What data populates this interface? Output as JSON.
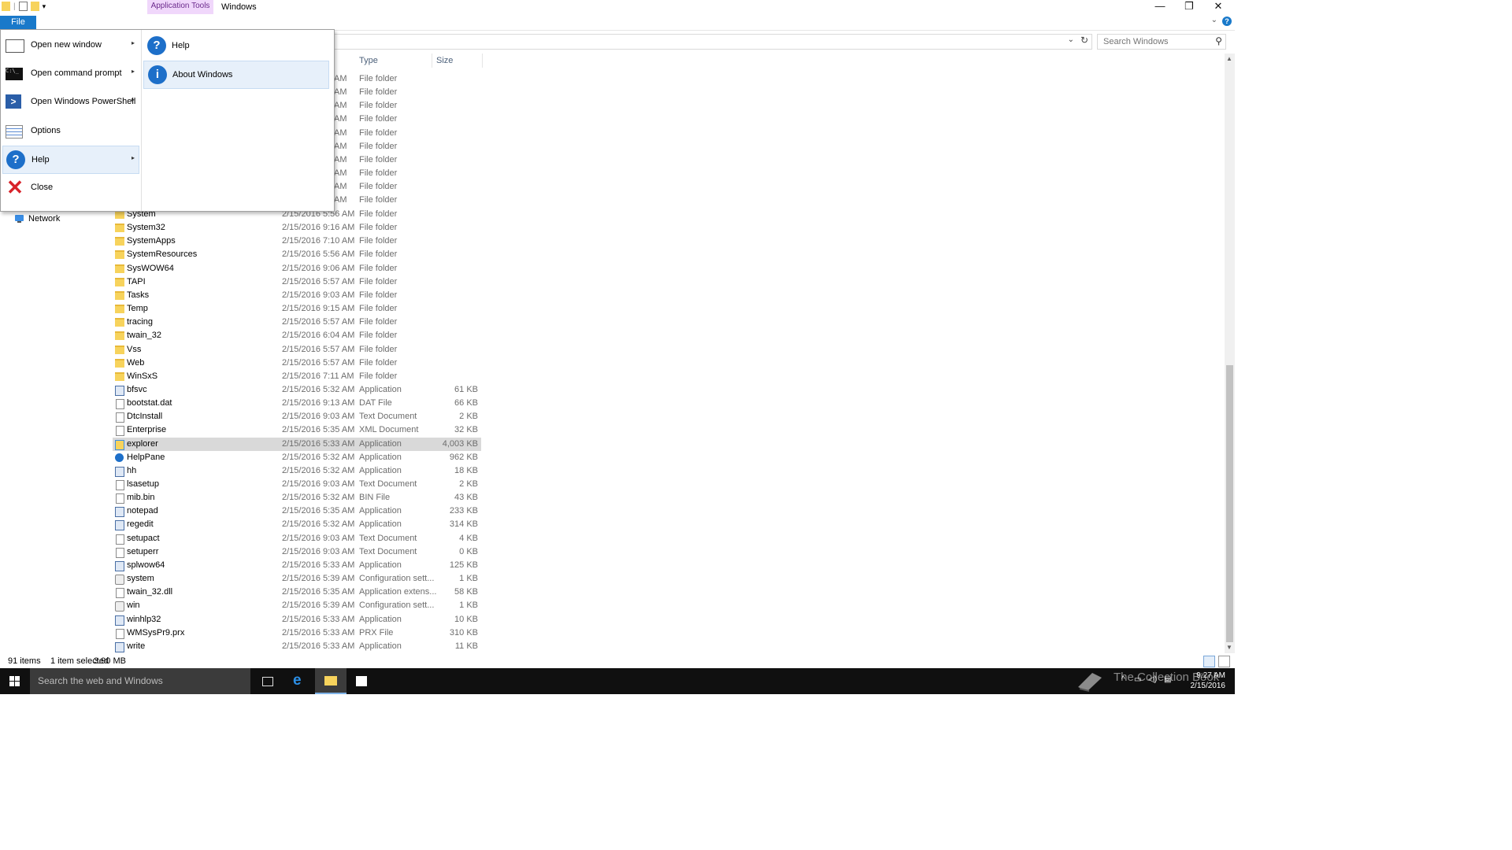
{
  "window": {
    "title": "Windows",
    "context_tab": "Application Tools",
    "ribbon_tab_file": "File"
  },
  "search": {
    "placeholder": "Search Windows"
  },
  "columns": {
    "type": "Type",
    "size": "Size"
  },
  "nav": {
    "network": "Network"
  },
  "partial_rows": [
    {
      "time": "AM",
      "type": "File folder"
    },
    {
      "time": "AM",
      "type": "File folder"
    },
    {
      "time": "AM",
      "type": "File folder"
    },
    {
      "time": "AM",
      "type": "File folder"
    },
    {
      "time": "AM",
      "type": "File folder"
    },
    {
      "time": "AM",
      "type": "File folder"
    },
    {
      "time": "AM",
      "type": "File folder"
    },
    {
      "time": "AM",
      "type": "File folder"
    },
    {
      "time": "AM",
      "type": "File folder"
    },
    {
      "time": "AM",
      "type": "File folder"
    }
  ],
  "files": [
    {
      "name": "System",
      "date": "2/15/2016 5:56 AM",
      "type": "File folder",
      "size": "",
      "icon": "folder"
    },
    {
      "name": "System32",
      "date": "2/15/2016 9:16 AM",
      "type": "File folder",
      "size": "",
      "icon": "folder"
    },
    {
      "name": "SystemApps",
      "date": "2/15/2016 7:10 AM",
      "type": "File folder",
      "size": "",
      "icon": "folder"
    },
    {
      "name": "SystemResources",
      "date": "2/15/2016 5:56 AM",
      "type": "File folder",
      "size": "",
      "icon": "folder"
    },
    {
      "name": "SysWOW64",
      "date": "2/15/2016 9:06 AM",
      "type": "File folder",
      "size": "",
      "icon": "folder"
    },
    {
      "name": "TAPI",
      "date": "2/15/2016 5:57 AM",
      "type": "File folder",
      "size": "",
      "icon": "folder"
    },
    {
      "name": "Tasks",
      "date": "2/15/2016 9:03 AM",
      "type": "File folder",
      "size": "",
      "icon": "folder"
    },
    {
      "name": "Temp",
      "date": "2/15/2016 9:15 AM",
      "type": "File folder",
      "size": "",
      "icon": "folder"
    },
    {
      "name": "tracing",
      "date": "2/15/2016 5:57 AM",
      "type": "File folder",
      "size": "",
      "icon": "folder"
    },
    {
      "name": "twain_32",
      "date": "2/15/2016 6:04 AM",
      "type": "File folder",
      "size": "",
      "icon": "folder"
    },
    {
      "name": "Vss",
      "date": "2/15/2016 5:57 AM",
      "type": "File folder",
      "size": "",
      "icon": "folder"
    },
    {
      "name": "Web",
      "date": "2/15/2016 5:57 AM",
      "type": "File folder",
      "size": "",
      "icon": "folder"
    },
    {
      "name": "WinSxS",
      "date": "2/15/2016 7:11 AM",
      "type": "File folder",
      "size": "",
      "icon": "folder"
    },
    {
      "name": "bfsvc",
      "date": "2/15/2016 5:32 AM",
      "type": "Application",
      "size": "61 KB",
      "icon": "app"
    },
    {
      "name": "bootstat.dat",
      "date": "2/15/2016 9:13 AM",
      "type": "DAT File",
      "size": "66 KB",
      "icon": "doc"
    },
    {
      "name": "DtcInstall",
      "date": "2/15/2016 9:03 AM",
      "type": "Text Document",
      "size": "2 KB",
      "icon": "doc"
    },
    {
      "name": "Enterprise",
      "date": "2/15/2016 5:35 AM",
      "type": "XML Document",
      "size": "32 KB",
      "icon": "doc"
    },
    {
      "name": "explorer",
      "date": "2/15/2016 5:33 AM",
      "type": "Application",
      "size": "4,003 KB",
      "icon": "exp",
      "selected": true
    },
    {
      "name": "HelpPane",
      "date": "2/15/2016 5:32 AM",
      "type": "Application",
      "size": "962 KB",
      "icon": "help"
    },
    {
      "name": "hh",
      "date": "2/15/2016 5:32 AM",
      "type": "Application",
      "size": "18 KB",
      "icon": "app"
    },
    {
      "name": "lsasetup",
      "date": "2/15/2016 9:03 AM",
      "type": "Text Document",
      "size": "2 KB",
      "icon": "doc"
    },
    {
      "name": "mib.bin",
      "date": "2/15/2016 5:32 AM",
      "type": "BIN File",
      "size": "43 KB",
      "icon": "doc"
    },
    {
      "name": "notepad",
      "date": "2/15/2016 5:35 AM",
      "type": "Application",
      "size": "233 KB",
      "icon": "app"
    },
    {
      "name": "regedit",
      "date": "2/15/2016 5:32 AM",
      "type": "Application",
      "size": "314 KB",
      "icon": "app"
    },
    {
      "name": "setupact",
      "date": "2/15/2016 9:03 AM",
      "type": "Text Document",
      "size": "4 KB",
      "icon": "doc"
    },
    {
      "name": "setuperr",
      "date": "2/15/2016 9:03 AM",
      "type": "Text Document",
      "size": "0 KB",
      "icon": "doc"
    },
    {
      "name": "splwow64",
      "date": "2/15/2016 5:33 AM",
      "type": "Application",
      "size": "125 KB",
      "icon": "app"
    },
    {
      "name": "system",
      "date": "2/15/2016 5:39 AM",
      "type": "Configuration sett...",
      "size": "1 KB",
      "icon": "cfg"
    },
    {
      "name": "twain_32.dll",
      "date": "2/15/2016 5:35 AM",
      "type": "Application extens...",
      "size": "58 KB",
      "icon": "doc"
    },
    {
      "name": "win",
      "date": "2/15/2016 5:39 AM",
      "type": "Configuration sett...",
      "size": "1 KB",
      "icon": "cfg"
    },
    {
      "name": "winhlp32",
      "date": "2/15/2016 5:33 AM",
      "type": "Application",
      "size": "10 KB",
      "icon": "app"
    },
    {
      "name": "WMSysPr9.prx",
      "date": "2/15/2016 5:33 AM",
      "type": "PRX File",
      "size": "310 KB",
      "icon": "doc"
    },
    {
      "name": "write",
      "date": "2/15/2016 5:33 AM",
      "type": "Application",
      "size": "11 KB",
      "icon": "app"
    }
  ],
  "status": {
    "count": "91 items",
    "selected": "1 item selected",
    "size": "3.90 MB"
  },
  "file_menu": {
    "items": [
      {
        "label": "Open new window",
        "icon": "window-icon",
        "submenu": true
      },
      {
        "label": "Open command prompt",
        "icon": "command-prompt-icon",
        "submenu": true
      },
      {
        "label": "Open Windows PowerShell",
        "icon": "powershell-icon",
        "submenu": true
      },
      {
        "label": "Options",
        "icon": "options-icon",
        "submenu": false
      },
      {
        "label": "Help",
        "icon": "help-icon",
        "submenu": true,
        "active": true
      },
      {
        "label": "Close",
        "icon": "close-icon",
        "submenu": false
      }
    ],
    "help_submenu": [
      {
        "label": "Help",
        "icon": "help-icon"
      },
      {
        "label": "About Windows",
        "icon": "info-icon",
        "active": true
      }
    ]
  },
  "taskbar": {
    "search_text": "Search the web and Windows",
    "watermark": "The Collection Book",
    "time": "9:27 AM",
    "date": "2/15/2016"
  },
  "colors": {
    "accent": "#1979ca",
    "context_tab_bg": "#f0d7fb",
    "selection": "#d9d9d9",
    "taskbar": "#101010"
  }
}
